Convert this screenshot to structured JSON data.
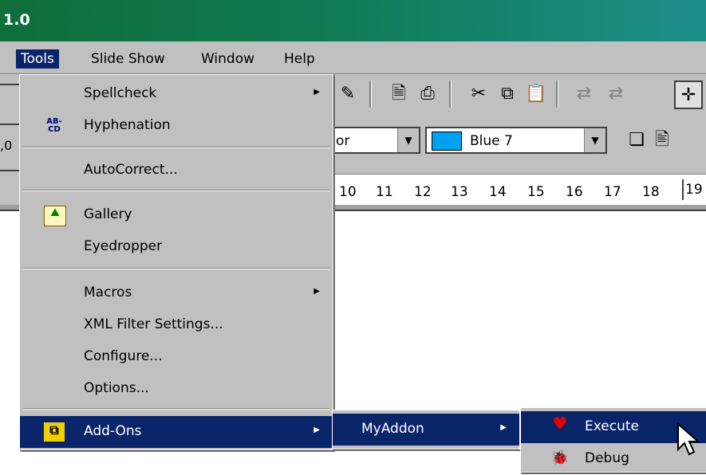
{
  "window": {
    "title_fragment": "1.0"
  },
  "menubar": {
    "tools": "Tools",
    "slideshow": "Slide Show",
    "window": "Window",
    "help": "Help"
  },
  "toolbar": {
    "color_combo_left_text": "or",
    "color_combo_value": "Blue 7",
    "color_swatch": "#00a0f0",
    "left_edge_text": ",0"
  },
  "ruler": {
    "ticks": [
      "10",
      "11",
      "12",
      "13",
      "14",
      "15",
      "16",
      "17",
      "18",
      "19"
    ]
  },
  "tools_menu": {
    "spellcheck": "Spellcheck",
    "hyphenation": "Hyphenation",
    "hyphenation_icon_text": "AB-\nCD",
    "autocorrect": "AutoCorrect...",
    "gallery": "Gallery",
    "eyedropper": "Eyedropper",
    "macros": "Macros",
    "xml_filter": "XML Filter Settings...",
    "configure": "Configure...",
    "options": "Options...",
    "addons": "Add-Ons"
  },
  "addons_menu": {
    "myaddon": "MyAddon"
  },
  "myaddon_menu": {
    "execute": "Execute",
    "debug": "Debug"
  },
  "colors": {
    "highlight": "#0a246a",
    "menu_bg": "#c0c0c0"
  }
}
